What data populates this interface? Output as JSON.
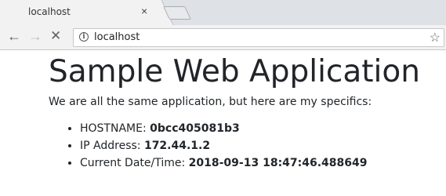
{
  "browser": {
    "tab": {
      "title": "localhost",
      "close": "×"
    },
    "toolbar": {
      "back": "←",
      "forward": "→",
      "stop": "✕",
      "url": "localhost",
      "info": "i",
      "star": "☆"
    }
  },
  "page": {
    "heading": "Sample Web Application",
    "intro": "We are all the same application, but here are my specifics:",
    "specifics": [
      {
        "label": "HOSTNAME:",
        "value": "0bcc405081b3"
      },
      {
        "label": "IP Address:",
        "value": "172.44.1.2"
      },
      {
        "label": "Current Date/Time:",
        "value": "2018-09-13 18:47:46.488649"
      }
    ]
  }
}
